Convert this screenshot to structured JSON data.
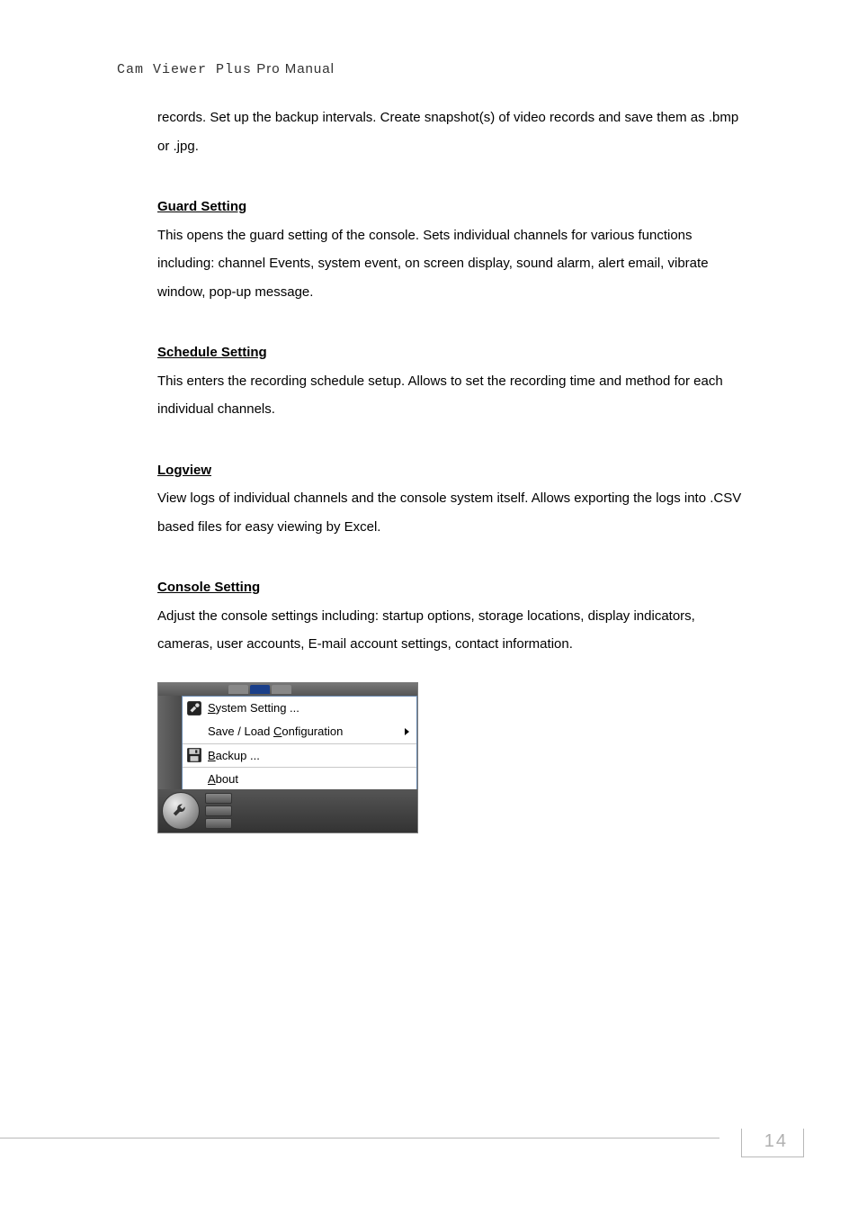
{
  "header": {
    "prefix": "Cam Viewer Plus",
    "suffix": " Pro Manual"
  },
  "intro": "records. Set up the backup intervals. Create snapshot(s) of video records and save them as .bmp or .jpg.",
  "sections": [
    {
      "title": "Guard Setting",
      "body": "This opens the guard setting of the console. Sets individual channels for various functions including: channel Events, system event, on screen display, sound alarm, alert email, vibrate window, pop-up message."
    },
    {
      "title": "Schedule Setting",
      "body": "This enters the recording schedule setup. Allows to set the recording time and method for each individual channels."
    },
    {
      "title": "Logview",
      "body": "View logs of individual channels and the console system itself. Allows exporting the logs into .CSV based files for easy viewing by Excel."
    },
    {
      "title": "Console Setting",
      "body": "Adjust the console settings including: startup options, storage locations, display indicators, cameras, user accounts, E-mail account settings, contact information."
    }
  ],
  "menu": {
    "items": [
      {
        "label_pre": "S",
        "label_rest": "ystem Setting ...",
        "icon": "wrench",
        "submenu": false
      },
      {
        "label_pre": "",
        "label_mid": "Save / Load ",
        "label_ul": "C",
        "label_rest": "onfiguration",
        "icon": "",
        "submenu": true
      },
      {
        "label_pre": "B",
        "label_rest": "ackup ...",
        "icon": "disk",
        "submenu": false,
        "sep": true
      },
      {
        "label_pre": "A",
        "label_rest": "bout",
        "icon": "",
        "submenu": false,
        "sep": true
      }
    ]
  },
  "page_number": "14"
}
